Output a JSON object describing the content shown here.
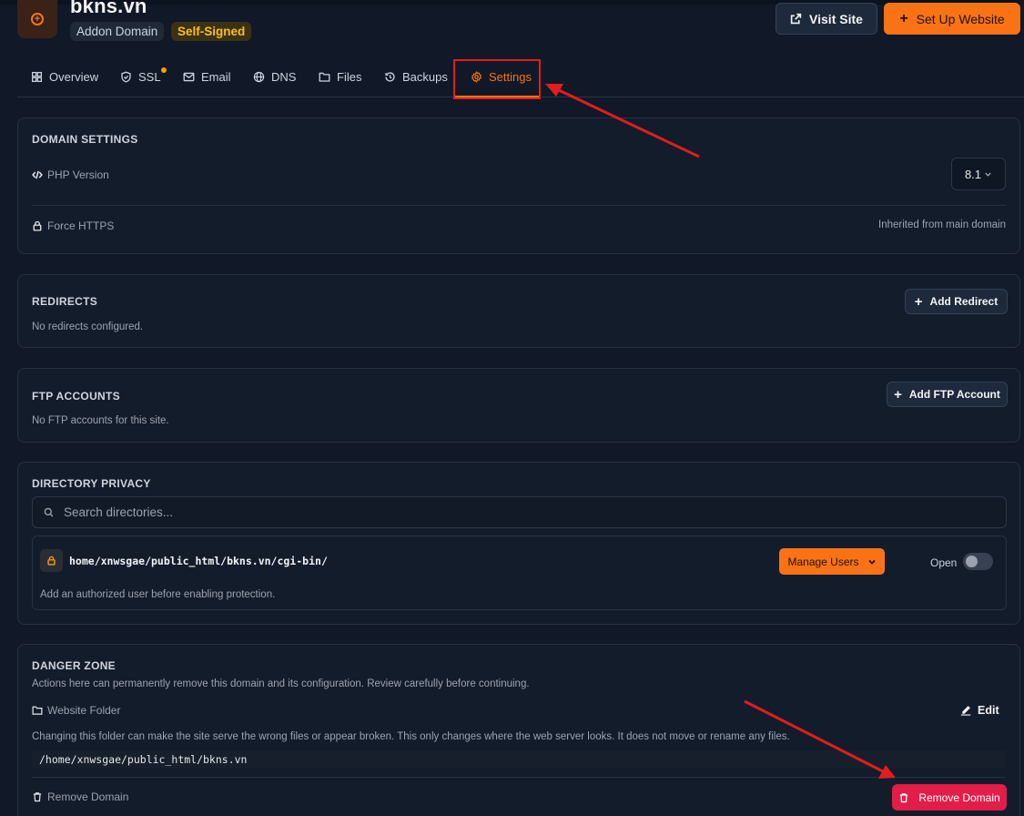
{
  "header": {
    "site_name": "bkns.vn",
    "badge_addon": "Addon Domain",
    "badge_ssl": "Self-Signed",
    "visit_label": "Visit Site",
    "setup_label": "Set Up Website"
  },
  "tabs": [
    {
      "label": "Overview",
      "icon": "grid-icon"
    },
    {
      "label": "SSL",
      "icon": "shield-icon"
    },
    {
      "label": "Email",
      "icon": "mail-icon"
    },
    {
      "label": "DNS",
      "icon": "globe-icon"
    },
    {
      "label": "Files",
      "icon": "folder-icon"
    },
    {
      "label": "Backups",
      "icon": "history-icon"
    },
    {
      "label": "Settings",
      "icon": "gear-icon",
      "active": true
    }
  ],
  "domain_settings": {
    "title": "DOMAIN SETTINGS",
    "php_label": "PHP Version",
    "php_value": "8.1",
    "https_label": "Force HTTPS",
    "https_value": "Inherited from main domain"
  },
  "redirects": {
    "title": "REDIRECTS",
    "empty": "No redirects configured.",
    "add_label": "Add Redirect"
  },
  "ftp": {
    "title": "FTP ACCOUNTS",
    "empty": "No FTP accounts for this site.",
    "add_label": "Add FTP Account"
  },
  "privacy": {
    "title": "DIRECTORY PRIVACY",
    "search_placeholder": "Search directories...",
    "dir_path": "home/xnwsgae/public_html/bkns.vn/cgi-bin/",
    "manage_label": "Manage Users",
    "status_label": "Open",
    "hint": "Add an authorized user before enabling protection."
  },
  "danger": {
    "title": "DANGER ZONE",
    "description": "Actions here can permanently remove this domain and its configuration. Review carefully before continuing.",
    "folder_label": "Website Folder",
    "edit_label": "Edit",
    "folder_warning": "Changing this folder can make the site serve the wrong files or appear broken. This only changes where the web server looks. It does not move or rename any files.",
    "folder_path": "/home/xnwsgae/public_html/bkns.vn",
    "remove_row_label": "Remove Domain",
    "remove_button": "Remove Domain"
  },
  "colors": {
    "accent": "#f97316",
    "danger": "#e11d48",
    "annotation": "#e11d1d",
    "background": "#111827"
  }
}
